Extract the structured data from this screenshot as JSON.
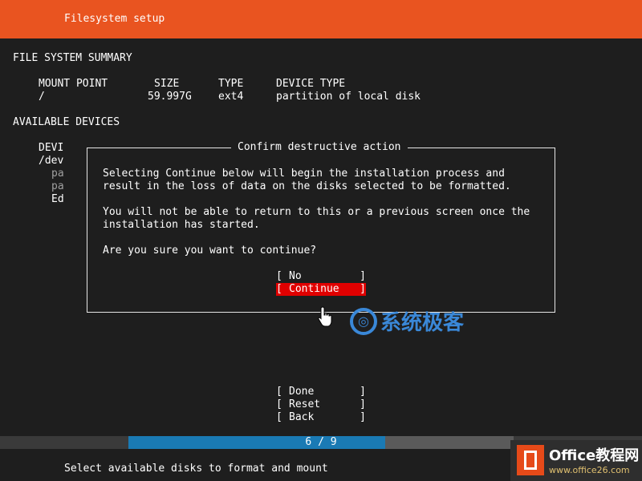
{
  "header": {
    "title": "Filesystem setup"
  },
  "summary": {
    "heading": "FILE SYSTEM SUMMARY",
    "columns": [
      "MOUNT POINT",
      "SIZE",
      "TYPE",
      "DEVICE TYPE"
    ],
    "row": {
      "mount": "/",
      "size": "59.997G",
      "type": "ext4",
      "device_type": "partition of local disk"
    }
  },
  "available": {
    "heading": "AVAILABLE DEVICES",
    "partial": [
      "DEVI",
      "/dev",
      "pa",
      "pa",
      "Ed"
    ]
  },
  "dialog": {
    "title": "Confirm destructive action",
    "para1": [
      "Selecting Continue below will begin the installation process and",
      "result in the loss of data on the disks selected to be formatted."
    ],
    "para2": [
      "You will not be able to return to this or a previous screen once the",
      "installation has started."
    ],
    "question": "Are you sure you want to continue?",
    "buttons": {
      "no": "No",
      "continue": "Continue"
    }
  },
  "bracket_open": "[",
  "bracket_close": "]",
  "actions": {
    "done": "Done",
    "reset": "Reset",
    "back": "Back"
  },
  "progress": {
    "text": "6 / 9",
    "fraction": 0.667
  },
  "footer": "Select available disks to format and mount",
  "watermarks": {
    "site_cn": "系统极客",
    "brand": "Office教程网",
    "url": "www.office26.com"
  },
  "colors": {
    "accent": "#e95420",
    "selected": "#e00000",
    "progress": "#1a7ab4"
  }
}
